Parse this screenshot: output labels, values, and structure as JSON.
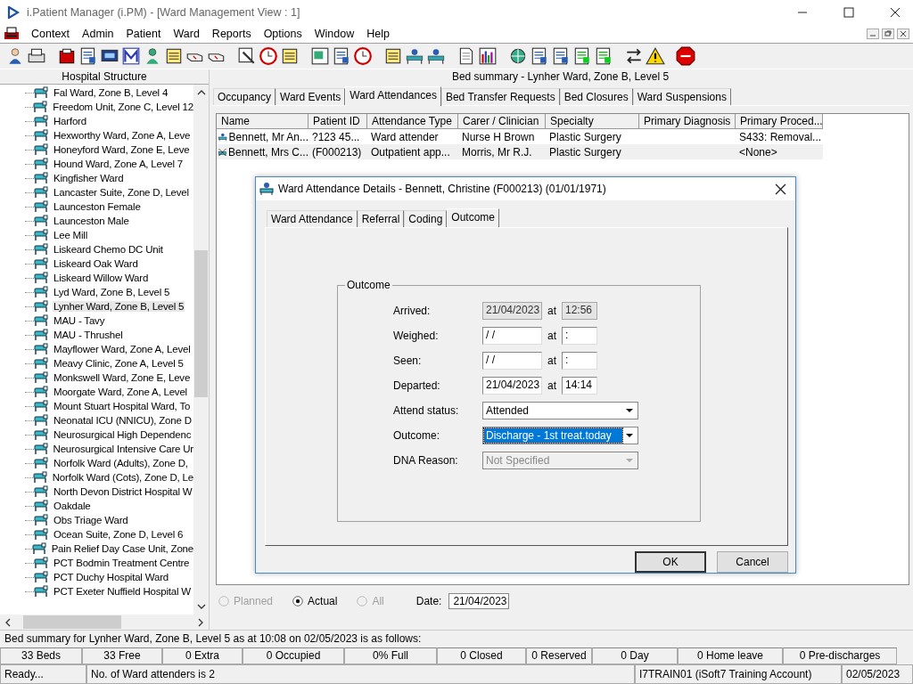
{
  "window": {
    "title": "i.Patient Manager (i.PM) - [Ward Management View : 1]"
  },
  "menu": [
    "Context",
    "Admin",
    "Patient",
    "Ward",
    "Reports",
    "Options",
    "Window",
    "Help"
  ],
  "sidebar": {
    "title": "Hospital Structure",
    "items": [
      {
        "label": "Fal Ward, Zone B, Level 4",
        "selected": false
      },
      {
        "label": "Freedom Unit, Zone C, Level 12",
        "selected": false
      },
      {
        "label": "Harford",
        "selected": false
      },
      {
        "label": "Hexworthy Ward, Zone A, Leve",
        "selected": false
      },
      {
        "label": "Honeyford Ward, Zone E, Leve",
        "selected": false
      },
      {
        "label": "Hound Ward, Zone A, Level 7",
        "selected": false
      },
      {
        "label": "Kingfisher Ward",
        "selected": false
      },
      {
        "label": "Lancaster Suite, Zone D, Level",
        "selected": false
      },
      {
        "label": "Launceston Female",
        "selected": false
      },
      {
        "label": "Launceston Male",
        "selected": false
      },
      {
        "label": "Lee Mill",
        "selected": false
      },
      {
        "label": "Liskeard Chemo DC Unit",
        "selected": false
      },
      {
        "label": "Liskeard Oak Ward",
        "selected": false
      },
      {
        "label": "Liskeard Willow Ward",
        "selected": false
      },
      {
        "label": "Lyd Ward, Zone B, Level 5",
        "selected": false
      },
      {
        "label": "Lynher Ward, Zone B, Level 5",
        "selected": true
      },
      {
        "label": "MAU - Tavy",
        "selected": false
      },
      {
        "label": "MAU - Thrushel",
        "selected": false
      },
      {
        "label": "Mayflower Ward, Zone A, Level",
        "selected": false
      },
      {
        "label": "Meavy Clinic, Zone A, Level 5",
        "selected": false
      },
      {
        "label": "Monkswell Ward, Zone E, Leve",
        "selected": false
      },
      {
        "label": "Moorgate Ward, Zone A, Level",
        "selected": false
      },
      {
        "label": "Mount Stuart Hospital Ward, To",
        "selected": false
      },
      {
        "label": "Neonatal ICU (NNICU), Zone D",
        "selected": false
      },
      {
        "label": "Neurosurgical High Dependenc",
        "selected": false
      },
      {
        "label": "Neurosurgical Intensive Care Ur",
        "selected": false
      },
      {
        "label": "Norfolk Ward (Adults), Zone D,",
        "selected": false
      },
      {
        "label": "Norfolk Ward (Cots), Zone D, Le",
        "selected": false
      },
      {
        "label": "North Devon District Hospital W",
        "selected": false
      },
      {
        "label": "Oakdale",
        "selected": false
      },
      {
        "label": "Obs Triage Ward",
        "selected": false
      },
      {
        "label": "Ocean Suite, Zone D, Level 6",
        "selected": false
      },
      {
        "label": "Pain Relief Day Case Unit, Zone",
        "selected": false
      },
      {
        "label": "PCT Bodmin Treatment Centre",
        "selected": false
      },
      {
        "label": "PCT Duchy Hospital Ward",
        "selected": false
      },
      {
        "label": "PCT Exeter Nuffield Hospital W",
        "selected": false
      }
    ]
  },
  "panel": {
    "title": "Bed summary - Lynher Ward, Zone B, Level 5"
  },
  "tabs": [
    {
      "label": "Occupancy",
      "selected": false
    },
    {
      "label": "Ward Events",
      "selected": false
    },
    {
      "label": "Ward Attendances",
      "selected": true
    },
    {
      "label": "Bed Transfer Requests",
      "selected": false
    },
    {
      "label": "Bed Closures",
      "selected": false
    },
    {
      "label": "Ward Suspensions",
      "selected": false
    }
  ],
  "table": {
    "columns": [
      "Name",
      "Patient ID",
      "Attendance Type",
      "Carer / Clinician",
      "Specialty",
      "Primary Diagnosis",
      "Primary Proced..."
    ],
    "rows": [
      {
        "kind": "attender",
        "selected": false,
        "cells": [
          "Bennett, Mr An...",
          "?123 45...",
          "Ward attender",
          "Nurse H Brown",
          "Plastic Surgery",
          "",
          "S433: Removal..."
        ]
      },
      {
        "kind": "outpatient",
        "selected": true,
        "cells": [
          "Bennett, Mrs C...",
          "(F000213)",
          "Outpatient app...",
          "Morris, Mr R.J.",
          "Plastic Surgery",
          "",
          "<None>"
        ]
      }
    ]
  },
  "filter": {
    "radios": [
      {
        "label": "Planned",
        "selected": false,
        "disabled": true
      },
      {
        "label": "Actual",
        "selected": true,
        "disabled": false
      },
      {
        "label": "All",
        "selected": false,
        "disabled": true
      }
    ],
    "date_label": "Date:",
    "date": "21/04/2023"
  },
  "dialog": {
    "title": "Ward Attendance Details - Bennett, Christine (F000213) (01/01/1971)",
    "tabs": [
      {
        "label": "Ward Attendance",
        "selected": false
      },
      {
        "label": "Referral",
        "selected": false
      },
      {
        "label": "Coding",
        "selected": false
      },
      {
        "label": "Outcome",
        "selected": true
      }
    ],
    "group": "Outcome",
    "times": [
      {
        "label": "Arrived:",
        "date": "21/04/2023",
        "at": "at",
        "time": "12:56",
        "disabled": true
      },
      {
        "label": "Weighed:",
        "date": "/ /",
        "at": "at",
        "time": ":",
        "disabled": false
      },
      {
        "label": "Seen:",
        "date": "/ /",
        "at": "at",
        "time": ":",
        "disabled": false
      },
      {
        "label": "Departed:",
        "date": "21/04/2023",
        "at": "at",
        "time": "14:14",
        "disabled": false
      }
    ],
    "dropdowns": [
      {
        "label": "Attend status:",
        "value": "Attended",
        "focused": false,
        "disabled": false
      },
      {
        "label": "Outcome:",
        "value": "Discharge - 1st treat.today",
        "focused": true,
        "disabled": false
      },
      {
        "label": "DNA Reason:",
        "value": "Not Specified",
        "focused": false,
        "disabled": true
      }
    ],
    "buttons": [
      {
        "label": "OK",
        "default": true
      },
      {
        "label": "Cancel",
        "default": false
      }
    ]
  },
  "summary": "Bed summary for Lynher Ward, Zone B, Level 5 as at 10:08 on 02/05/2023 is as follows:",
  "stats": [
    "33 Beds",
    "33 Free",
    "0 Extra",
    "0 Occupied",
    "0% Full",
    "0 Closed",
    "0 Reserved",
    "0 Day",
    "0 Home leave",
    "0 Pre-discharges"
  ],
  "status": [
    "Ready...",
    "No. of Ward attenders is 2",
    "I7TRAIN01 (iSoft7 Training Account)",
    "02/05/2023"
  ]
}
